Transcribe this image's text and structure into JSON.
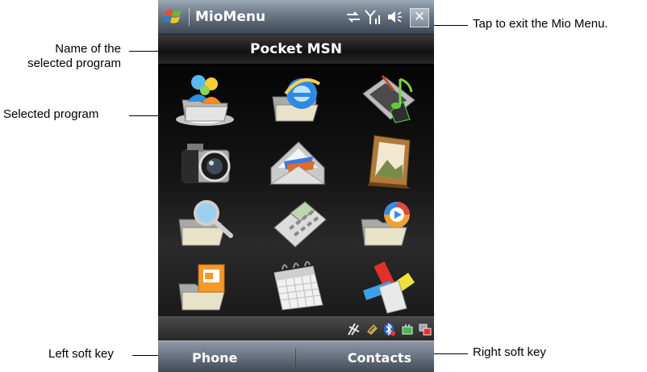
{
  "window": {
    "title": "MioMenu",
    "close_label": "✕"
  },
  "program_bar": {
    "name": "Pocket MSN"
  },
  "softkeys": {
    "left": "Phone",
    "right": "Contacts"
  },
  "callouts": {
    "tap_exit": "Tap to exit the Mio Menu.",
    "name_line1": "Name of the",
    "name_line2": "selected program",
    "selected_program": "Selected program",
    "left_soft_key": "Left soft key",
    "right_soft_key": "Right soft key"
  },
  "programs": [
    {
      "icon": "pocket-msn-icon",
      "selected": true
    },
    {
      "icon": "internet-explorer-icon",
      "selected": false
    },
    {
      "icon": "media-tablet-icon",
      "selected": false
    },
    {
      "icon": "camera-icon",
      "selected": false
    },
    {
      "icon": "messaging-icon",
      "selected": false
    },
    {
      "icon": "pictures-icon",
      "selected": false
    },
    {
      "icon": "file-explorer-icon",
      "selected": false
    },
    {
      "icon": "calculator-icon",
      "selected": false
    },
    {
      "icon": "media-folder-icon",
      "selected": false
    },
    {
      "icon": "office-folder-icon",
      "selected": false
    },
    {
      "icon": "calendar-icon",
      "selected": false
    },
    {
      "icon": "settings-tools-icon",
      "selected": false
    }
  ],
  "status_icons": [
    "connectivity-icon",
    "signal-icon",
    "volume-icon"
  ],
  "tray_icons": [
    "wireless-manager-icon",
    "storage-card-icon",
    "bluetooth-icon",
    "battery-icon",
    "connection-icon"
  ],
  "colors": {
    "screen_bg": "#0c0c0c",
    "titlebar": "#6e7b8a",
    "text": "#ffffff"
  }
}
